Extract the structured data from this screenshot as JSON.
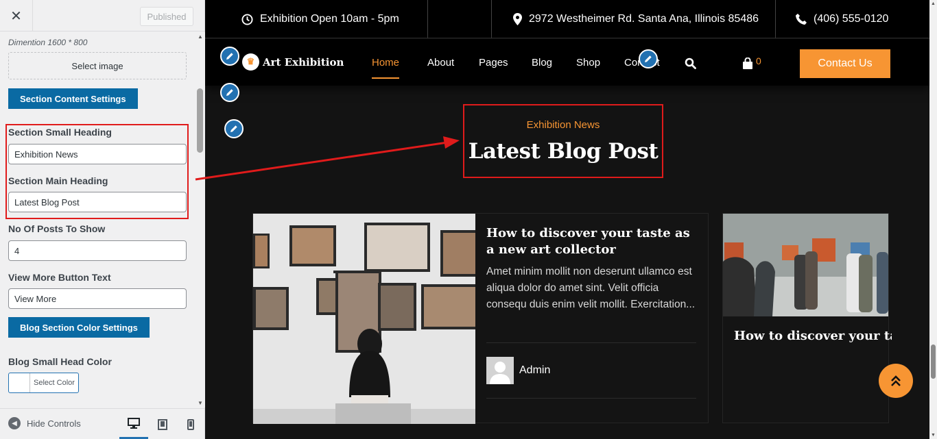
{
  "customizer": {
    "published_label": "Published",
    "dimension_note": "Dimention 1600 * 800",
    "select_image_label": "Select image",
    "section_content_settings_label": "Section Content Settings",
    "fields": [
      {
        "label": "Section Small Heading",
        "value": "Exhibition News"
      },
      {
        "label": "Section Main Heading",
        "value": "Latest Blog Post"
      },
      {
        "label": "No Of Posts To Show",
        "value": "4"
      },
      {
        "label": "View More Button Text",
        "value": "View More"
      }
    ],
    "color_settings_label": "Blog Section Color Settings",
    "small_head_color_label": "Blog Small Head Color",
    "select_color_label": "Select Color",
    "hide_controls_label": "Hide Controls",
    "device_icons": [
      "desktop-icon",
      "tablet-icon",
      "mobile-icon"
    ]
  },
  "preview": {
    "topbar": {
      "hours": "Exhibition Open 10am - 5pm",
      "address": "2972 Westheimer Rd. Santa Ana, Illinois 85486",
      "phone": "(406) 555-0120"
    },
    "logo_text": "Art Exhibition",
    "nav": [
      "Home",
      "About",
      "Pages",
      "Blog",
      "Shop",
      "Contact"
    ],
    "cart_count": "0",
    "contact_button": "Contact Us",
    "section": {
      "small_heading": "Exhibition News",
      "main_heading": "Latest Blog Post"
    },
    "posts": [
      {
        "title": "How to discover your taste as a new art collector",
        "excerpt": "Amet minim mollit non deserunt ullamco est aliqua dolor do amet sint. Velit officia consequ duis enim velit mollit. Exercitation...",
        "author": "Admin"
      },
      {
        "title": "How to discover your taste as a new art collector"
      }
    ]
  },
  "colors": {
    "accent": "#f79533",
    "wp_blue": "#0a6aa3",
    "highlight_red": "#e01b1b",
    "preview_bg": "#131313"
  }
}
